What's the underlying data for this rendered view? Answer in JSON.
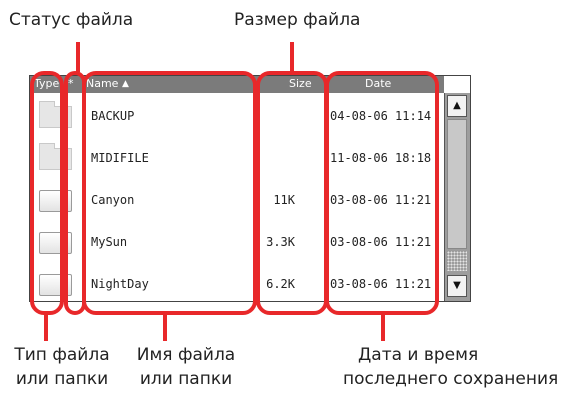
{
  "callouts": {
    "file_status": "Статус файла",
    "file_size": "Размер файла",
    "file_type_line1": "Тип файла",
    "file_type_line2": "или папки",
    "file_name_line1": "Имя файла",
    "file_name_line2": "или папки",
    "date_line1": "Дата и время",
    "date_line2": "последнего сохранения"
  },
  "table": {
    "headers": {
      "type": "Type",
      "status": "*",
      "name": "Name",
      "size": "Size",
      "date": "Date"
    },
    "sort_indicator": "▲",
    "sorted_by": "name",
    "rows": [
      {
        "kind": "folder",
        "icon": "folder-icon",
        "name": "BACKUP",
        "size": "",
        "date": "04-08-06 11:14"
      },
      {
        "kind": "folder",
        "icon": "folder-icon",
        "name": "MIDIFILE",
        "size": "",
        "date": "11-08-06 18:18"
      },
      {
        "kind": "file",
        "icon": "music-note-icon",
        "name": "Canyon",
        "size": "11K",
        "date": "03-08-06 11:21"
      },
      {
        "kind": "file",
        "icon": "music-note-icon",
        "name": "MySun",
        "size": "3.3K",
        "date": "03-08-06 11:21"
      },
      {
        "kind": "file",
        "icon": "music-note-icon",
        "name": "NightDay",
        "size": "6.2K",
        "date": "03-08-06 11:21"
      }
    ]
  },
  "scrollbar": {
    "up_glyph": "▲",
    "down_glyph": "▼"
  },
  "colors": {
    "highlight": "#e8282a",
    "header_bg": "#7b7b7b",
    "scrollbar_bg": "#9d9d9d"
  }
}
